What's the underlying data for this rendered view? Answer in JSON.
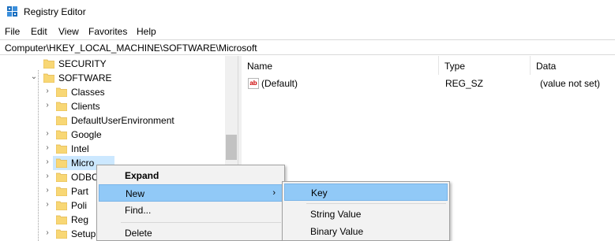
{
  "window": {
    "title": "Registry Editor",
    "colors": {
      "selection": "#cce8ff",
      "menu_highlight": "#91c9f7",
      "folder": "#f8d775"
    }
  },
  "menubar": [
    "File",
    "Edit",
    "View",
    "Favorites",
    "Help"
  ],
  "address": "Computer\\HKEY_LOCAL_MACHINE\\SOFTWARE\\Microsoft",
  "tree": {
    "items": [
      {
        "label": "SECURITY",
        "expanded": false
      },
      {
        "label": "SOFTWARE",
        "expanded": true
      },
      {
        "label": "Classes"
      },
      {
        "label": "Clients"
      },
      {
        "label": "DefaultUserEnvironment"
      },
      {
        "label": "Google"
      },
      {
        "label": "Intel"
      },
      {
        "label": "Micro",
        "selected": true
      },
      {
        "label": "ODBC"
      },
      {
        "label": "Part"
      },
      {
        "label": "Poli"
      },
      {
        "label": "Reg"
      },
      {
        "label": "Setup"
      }
    ]
  },
  "values": {
    "columns": [
      "Name",
      "Type",
      "Data"
    ],
    "rows": [
      {
        "name": "(Default)",
        "type": "REG_SZ",
        "data": "(value not set)",
        "icon": "string-value-icon"
      }
    ]
  },
  "context_menu": {
    "items": [
      "Expand",
      "New",
      "Find...",
      "Delete"
    ],
    "highlighted": "New"
  },
  "submenu": {
    "items": [
      "Key",
      "String Value",
      "Binary Value"
    ],
    "highlighted": "Key"
  }
}
